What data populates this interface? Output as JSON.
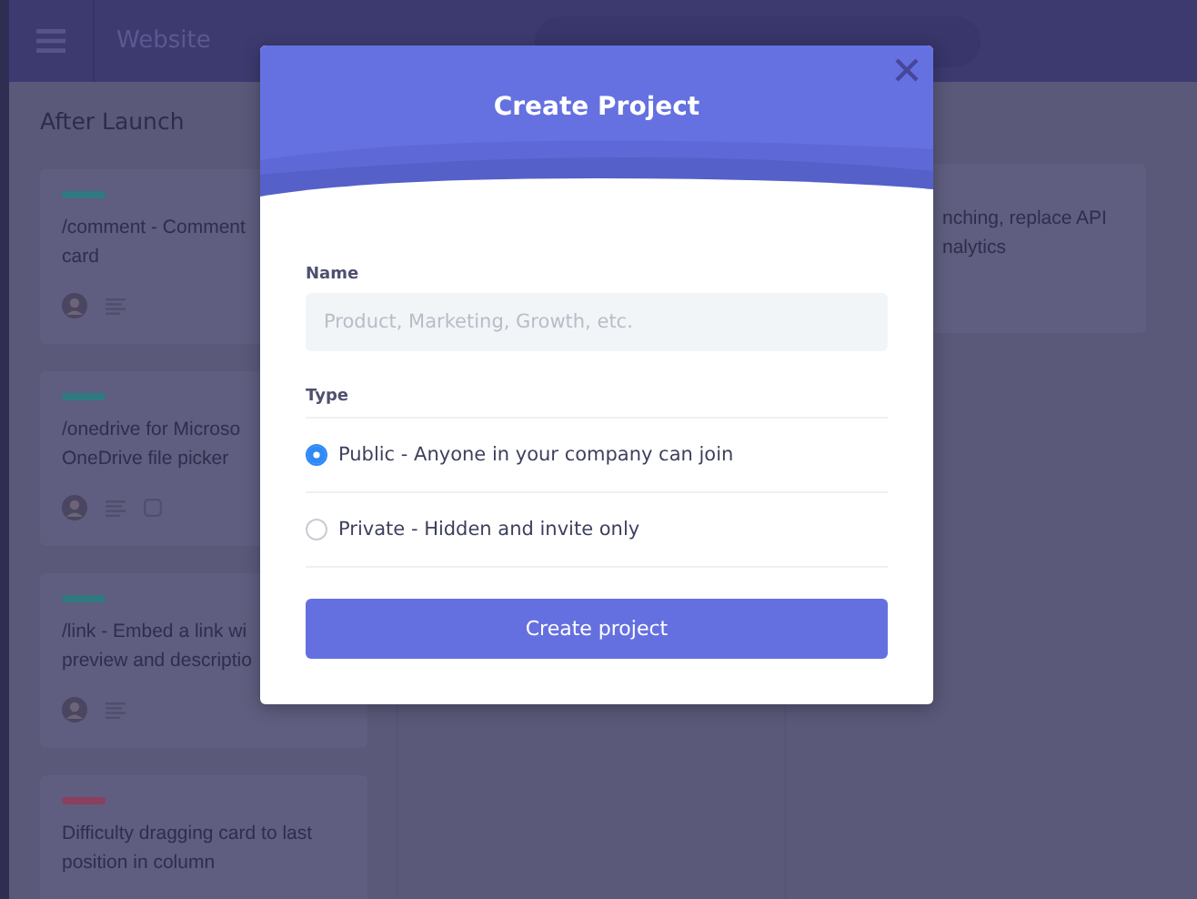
{
  "header": {
    "title": "Website"
  },
  "columns": [
    {
      "title": "After Launch",
      "cards": [
        {
          "color": "#2f7a80",
          "lines": [
            "/comment - Comment",
            "card"
          ],
          "icons": [
            {
              "kind": "avatar"
            },
            {
              "kind": "notes"
            }
          ]
        },
        {
          "color": "#2f7a80",
          "lines": [
            "/onedrive for Microso",
            "OneDrive file picker"
          ],
          "icons": [
            {
              "kind": "avatar"
            },
            {
              "kind": "notes"
            },
            {
              "kind": "checklist"
            }
          ]
        },
        {
          "color": "#2f7a80",
          "lines": [
            "/link - Embed a link wi",
            "preview and descriptio"
          ],
          "icons": [
            {
              "kind": "avatar"
            },
            {
              "kind": "notes"
            }
          ]
        },
        {
          "color": "#8a3f5e",
          "lines": [
            "Difficulty dragging card to last",
            "position in column"
          ]
        }
      ]
    },
    {
      "cards": [
        {
          "lines": [
            "nching, replace API",
            "nalytics"
          ]
        }
      ]
    }
  ],
  "modal": {
    "title": "Create Project",
    "name_label": "Name",
    "name_placeholder": "Product, Marketing, Growth, etc.",
    "type_label": "Type",
    "options": [
      {
        "label": "Public - Anyone in your company can join",
        "selected": true
      },
      {
        "label": "Private - Hidden and invite only",
        "selected": false
      }
    ],
    "button": "Create project"
  }
}
